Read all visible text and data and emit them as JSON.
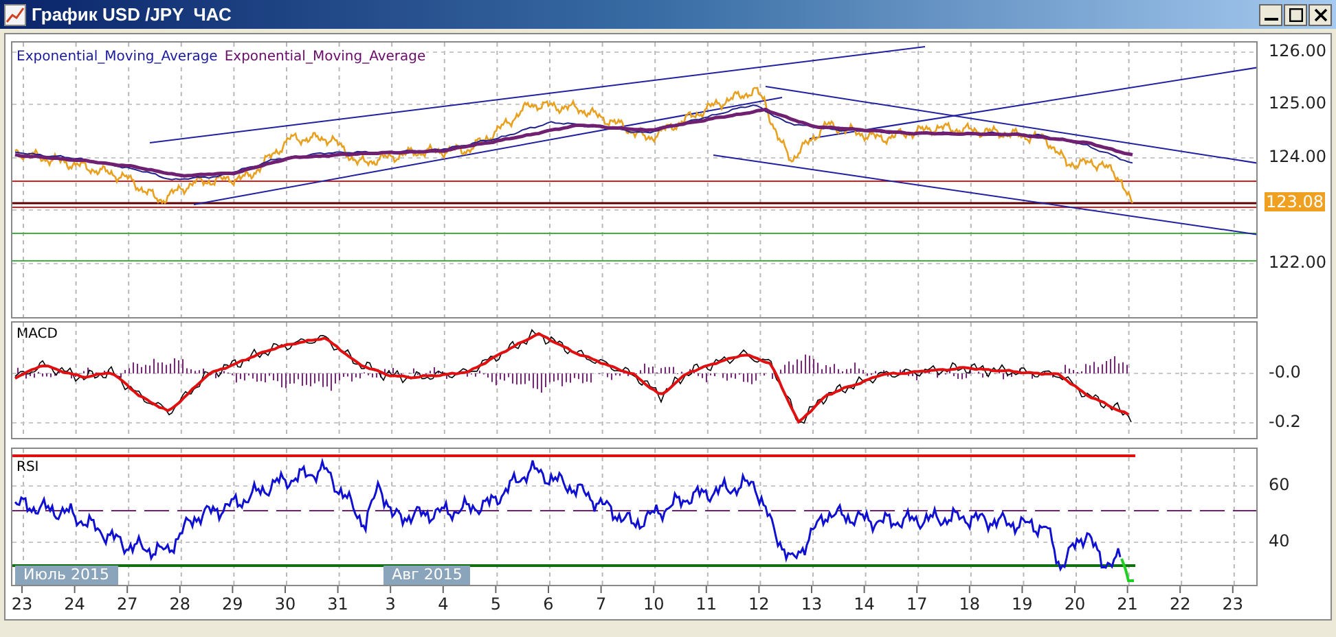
{
  "window": {
    "title": "График USD /JPY  ЧАС"
  },
  "main_panel": {
    "legend": [
      {
        "text": "Exponential_Moving_Average",
        "color": "#1a1a9c"
      },
      {
        "text": "Exponential_Moving_Average",
        "color": "#6a0a6a"
      }
    ],
    "y_labels": [
      "126.00",
      "125.00",
      "124.00",
      "122.00"
    ],
    "price_badge": "123.08"
  },
  "macd_panel": {
    "title": "MACD",
    "y_labels": [
      "-0.0",
      "-0.2"
    ]
  },
  "rsi_panel": {
    "title": "RSI",
    "y_labels": [
      "60",
      "40"
    ]
  },
  "x_axis": [
    {
      "text": "23",
      "month": "Июль 2015"
    },
    {
      "text": "24"
    },
    {
      "text": "27"
    },
    {
      "text": "28"
    },
    {
      "text": "29"
    },
    {
      "text": "30"
    },
    {
      "text": "31"
    },
    {
      "text": "3",
      "month": "Авг 2015"
    },
    {
      "text": "4"
    },
    {
      "text": "5"
    },
    {
      "text": "6"
    },
    {
      "text": "7"
    },
    {
      "text": "10"
    },
    {
      "text": "11"
    },
    {
      "text": "12"
    },
    {
      "text": "13"
    },
    {
      "text": "14"
    },
    {
      "text": "17"
    },
    {
      "text": "18"
    },
    {
      "text": "19"
    },
    {
      "text": "20"
    },
    {
      "text": "21"
    },
    {
      "text": "22"
    },
    {
      "text": "23"
    }
  ]
}
